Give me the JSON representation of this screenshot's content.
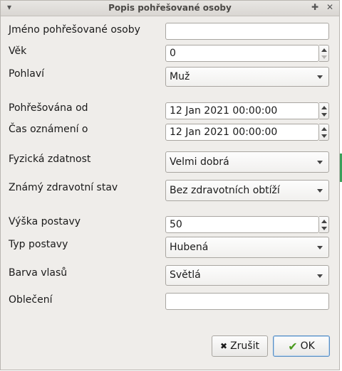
{
  "window": {
    "title": "Popis pohřešované osoby",
    "menu_icon": "chevron-down-icon",
    "maximize_icon": "plus-icon",
    "close_icon": "close-icon"
  },
  "fields": {
    "name": {
      "label": "Jméno pohřešované osoby",
      "value": ""
    },
    "age": {
      "label": "Věk",
      "value": "0"
    },
    "sex": {
      "label": "Pohlaví",
      "value": "Muž"
    },
    "missing_since": {
      "label": "Pohřešována od",
      "value": "12 Jan 2021 00:00:00"
    },
    "reported_at": {
      "label": "Čas oznámení o",
      "value": "12 Jan 2021 00:00:00"
    },
    "fitness": {
      "label": "Fyzická zdatnost",
      "value": "Velmi dobrá"
    },
    "health": {
      "label": "Známý zdravotní stav",
      "value": "Bez zdravotních obtíží"
    },
    "height": {
      "label": "Výška postavy",
      "value": "50"
    },
    "build": {
      "label": "Typ postavy",
      "value": "Hubená"
    },
    "hair": {
      "label": "Barva vlasů",
      "value": "Světlá"
    },
    "clothing": {
      "label": "Oblečení",
      "value": ""
    }
  },
  "buttons": {
    "cancel_label": "Zrušit",
    "ok_label": "OK"
  },
  "colors": {
    "window_bg": "#efedea",
    "accent": "#5a8fc3",
    "ok_check": "#4a9a1e"
  }
}
